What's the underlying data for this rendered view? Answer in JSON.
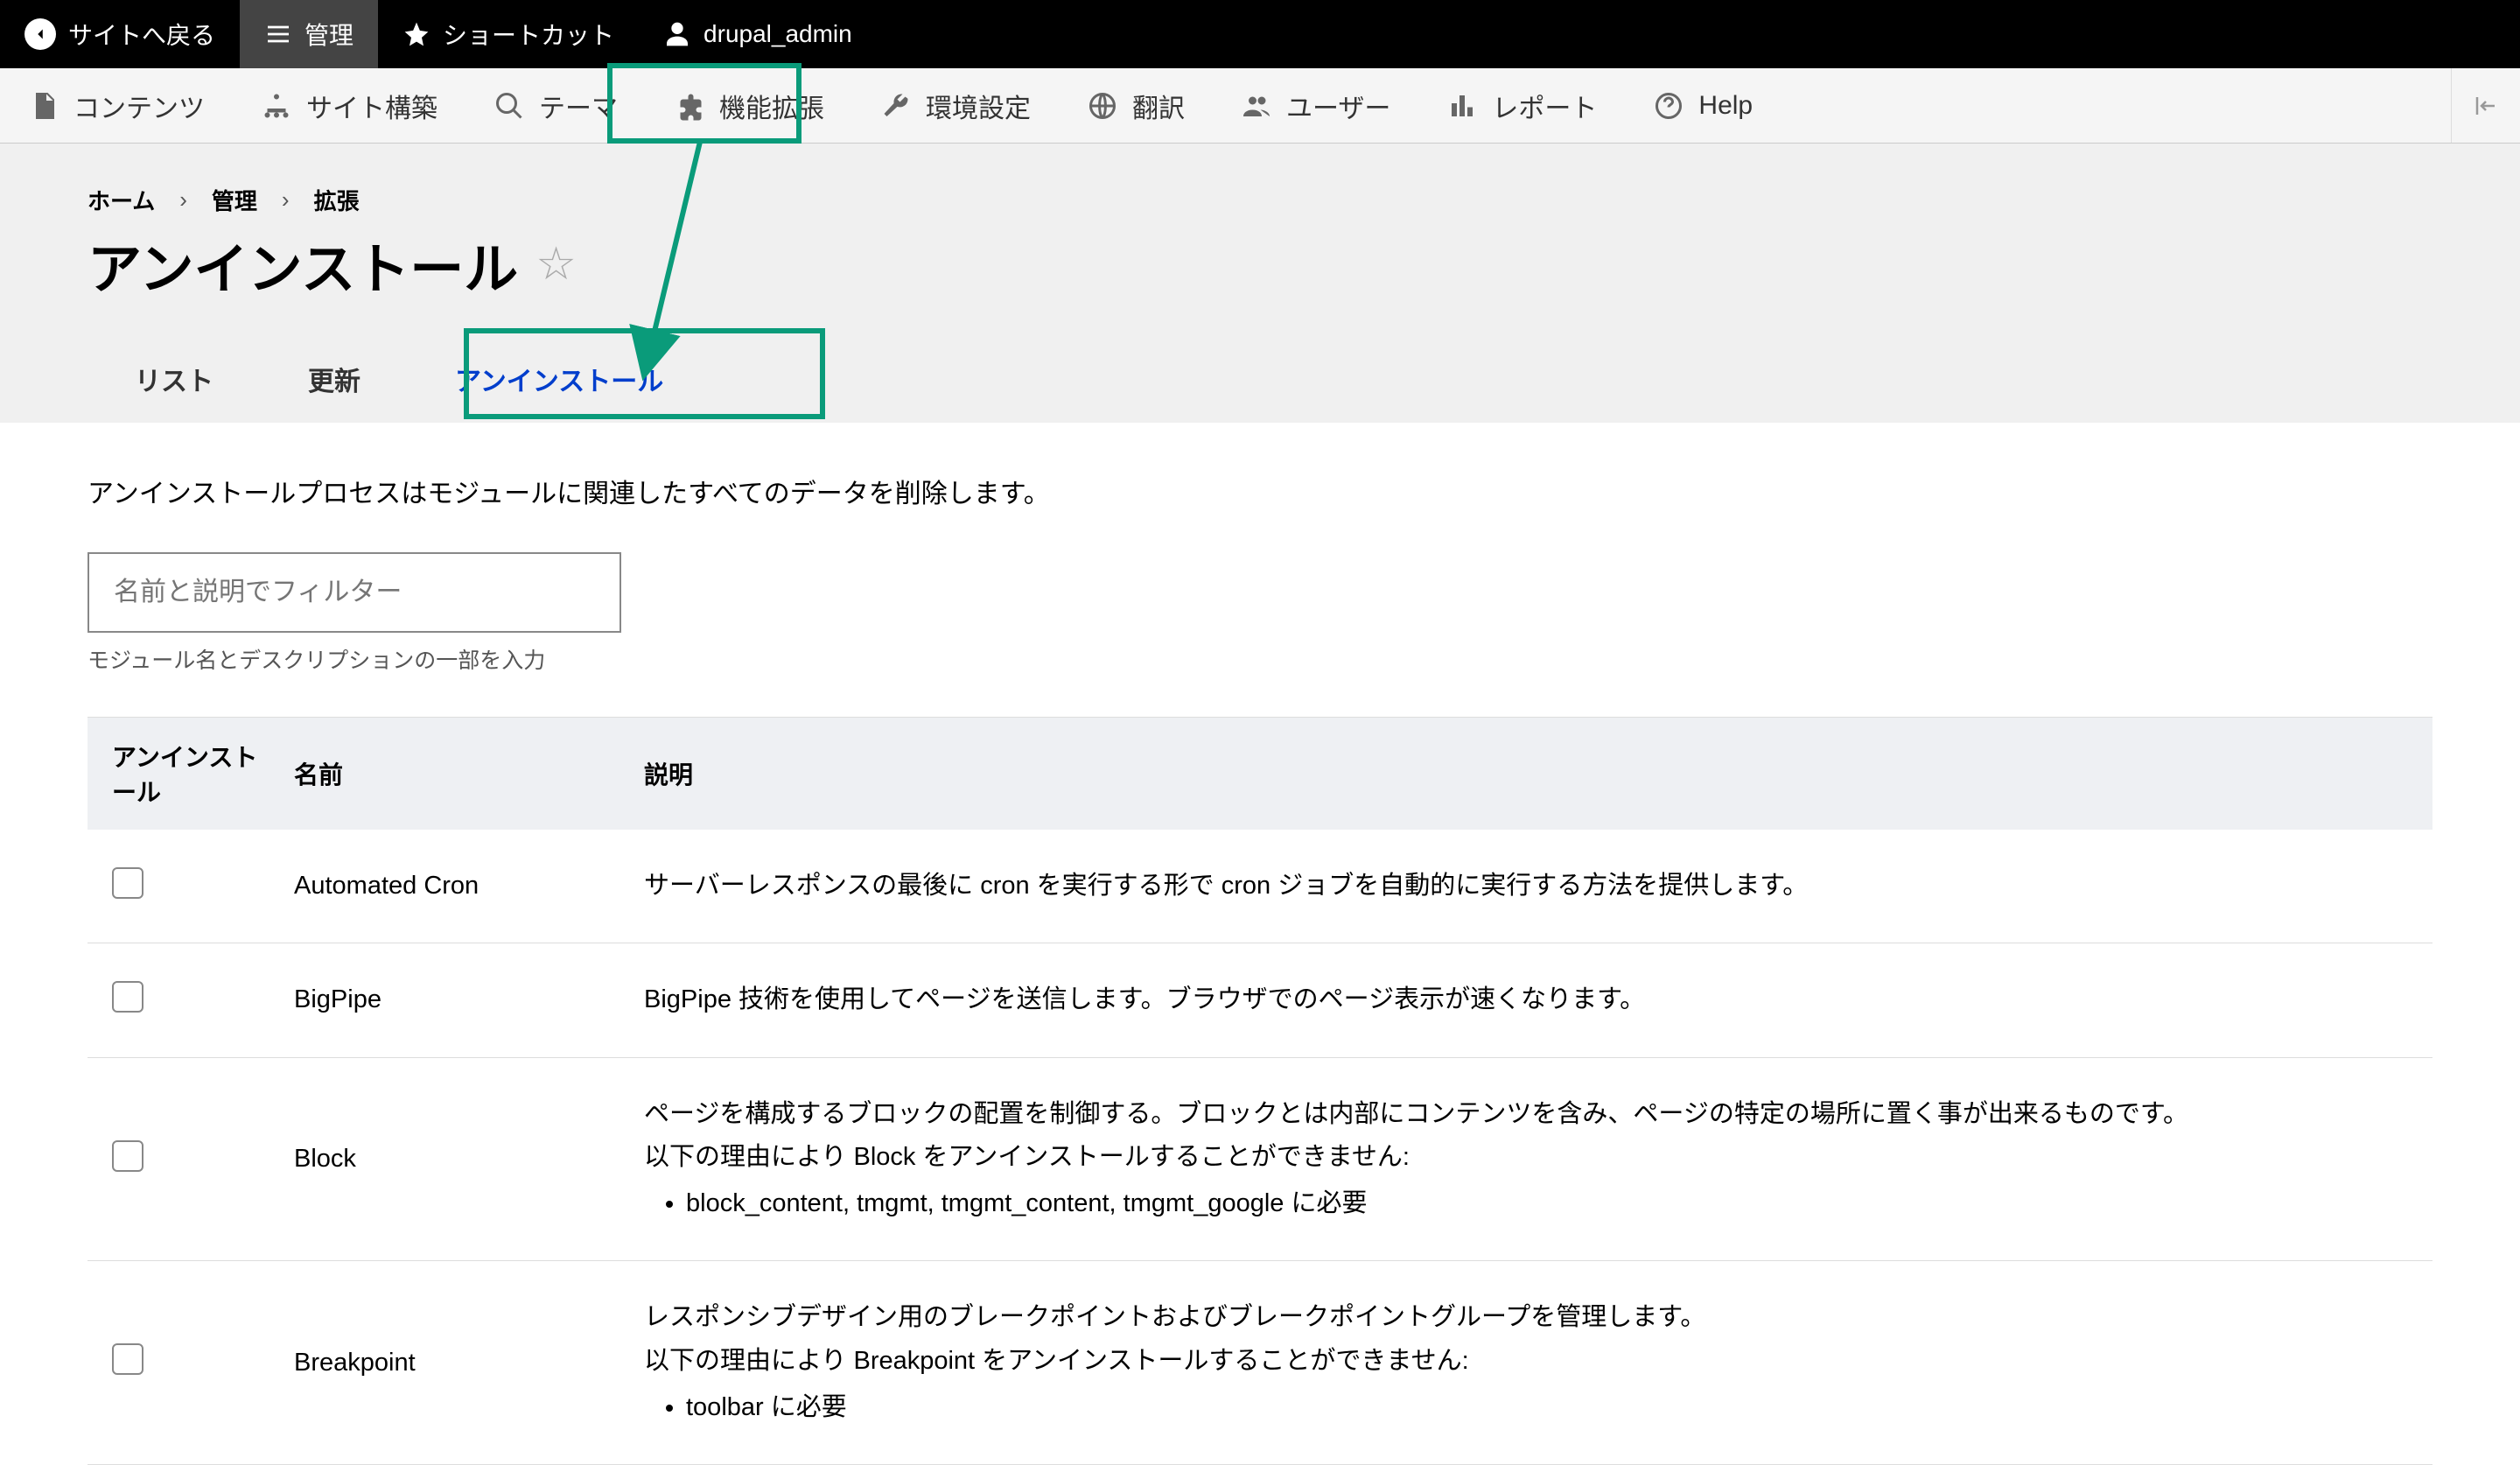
{
  "top_toolbar": {
    "back": "サイトへ戻る",
    "manage": "管理",
    "shortcuts": "ショートカット",
    "user": "drupal_admin"
  },
  "admin_menu": {
    "items": [
      {
        "label": "コンテンツ",
        "icon": "document",
        "id": "content"
      },
      {
        "label": "サイト構築",
        "icon": "structure",
        "id": "structure"
      },
      {
        "label": "テーマ",
        "icon": "appearance",
        "id": "appearance"
      },
      {
        "label": "機能拡張",
        "icon": "puzzle",
        "id": "extend"
      },
      {
        "label": "環境設定",
        "icon": "wrench",
        "id": "config"
      },
      {
        "label": "翻訳",
        "icon": "globe",
        "id": "translation"
      },
      {
        "label": "ユーザー",
        "icon": "user",
        "id": "people"
      },
      {
        "label": "レポート",
        "icon": "report",
        "id": "reports"
      },
      {
        "label": "Help",
        "icon": "help",
        "id": "help"
      }
    ]
  },
  "breadcrumb": {
    "items": [
      "ホーム",
      "管理",
      "拡張"
    ]
  },
  "page_title": "アンインストール",
  "tabs": {
    "items": [
      {
        "label": "リスト",
        "id": "list"
      },
      {
        "label": "更新",
        "id": "update"
      },
      {
        "label": "アンインストール",
        "id": "uninstall"
      }
    ],
    "active": "uninstall"
  },
  "description": "アンインストールプロセスはモジュールに関連したすべてのデータを削除します。",
  "filter": {
    "placeholder": "名前と説明でフィルター",
    "help": "モジュール名とデスクリプションの一部を入力"
  },
  "table": {
    "headers": {
      "uninstall": "アンインストール",
      "name": "名前",
      "description": "説明"
    },
    "rows": [
      {
        "name": "Automated Cron",
        "desc": "サーバーレスポンスの最後に cron を実行する形で cron ジョブを自動的に実行する方法を提供します。",
        "disabled": false
      },
      {
        "name": "BigPipe",
        "desc": "BigPipe 技術を使用してページを送信します。ブラウザでのページ表示が速くなります。",
        "disabled": false
      },
      {
        "name": "Block",
        "desc": "ページを構成するブロックの配置を制御する。ブロックとは内部にコンテンツを含み、ページの特定の場所に置く事が出来るものです。",
        "reason": "以下の理由により Block をアンインストールすることができません:",
        "deps": "block_content, tmgmt, tmgmt_content, tmgmt_google に必要",
        "disabled": true
      },
      {
        "name": "Breakpoint",
        "desc": "レスポンシブデザイン用のブレークポイントおよびブレークポイントグループを管理します。",
        "reason": "以下の理由により Breakpoint をアンインストールすることができません:",
        "deps": "toolbar に必要",
        "disabled": true
      }
    ]
  }
}
